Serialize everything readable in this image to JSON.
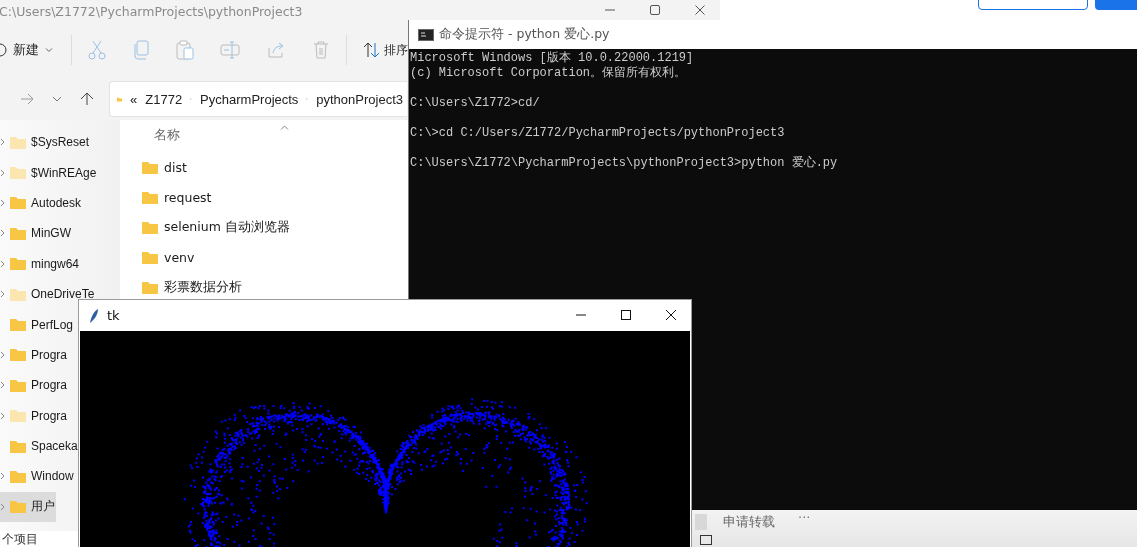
{
  "explorer": {
    "title": "C:\\Users\\Z1772\\PycharmProjects\\pythonProject3",
    "toolbar": {
      "new_label": "新建",
      "sort_label": "排序"
    },
    "address": {
      "prefix": "«",
      "segments": [
        "Z1772",
        "PycharmProjects",
        "pythonProject3"
      ]
    },
    "sidebar": {
      "items": [
        {
          "label": "$SysReset",
          "hidden": true,
          "expandable": true,
          "selected": false
        },
        {
          "label": "$WinREAge",
          "hidden": true,
          "expandable": true,
          "selected": false
        },
        {
          "label": "Autodesk",
          "hidden": false,
          "expandable": true,
          "selected": false
        },
        {
          "label": "MinGW",
          "hidden": false,
          "expandable": true,
          "selected": false
        },
        {
          "label": "mingw64",
          "hidden": false,
          "expandable": true,
          "selected": false
        },
        {
          "label": "OneDriveTe",
          "hidden": true,
          "expandable": true,
          "selected": false
        },
        {
          "label": "PerfLog",
          "hidden": false,
          "expandable": false,
          "selected": false
        },
        {
          "label": "Progra",
          "hidden": false,
          "expandable": true,
          "selected": false
        },
        {
          "label": "Progra",
          "hidden": false,
          "expandable": true,
          "selected": false
        },
        {
          "label": "Progra",
          "hidden": true,
          "expandable": true,
          "selected": false
        },
        {
          "label": "Spaceka",
          "hidden": false,
          "expandable": false,
          "selected": false
        },
        {
          "label": "Window",
          "hidden": false,
          "expandable": true,
          "selected": false
        },
        {
          "label": "用户",
          "hidden": false,
          "expandable": true,
          "selected": true
        }
      ]
    },
    "list": {
      "column": "名称",
      "items": [
        "dist",
        "request",
        "selenium 自动浏览器",
        "venv",
        "彩票数据分析"
      ]
    },
    "status_bar": "个项目"
  },
  "cmd": {
    "title": "命令提示符 - python  爱心.py",
    "lines": [
      {
        "text": "Microsoft Windows [版本 10.0.22000.1219]",
        "gap_before": false
      },
      {
        "text": "(c) Microsoft Corporation。保留所有权利。",
        "gap_before": false
      },
      {
        "text": "C:\\Users\\Z1772>cd/",
        "gap_before": true
      },
      {
        "text": "C:\\>cd C:/Users/Z1772/PycharmProjects/pythonProject3",
        "gap_before": true
      },
      {
        "text": "C:\\Users\\Z1772\\PycharmProjects\\pythonProject3>python 爱心.py",
        "gap_before": true
      }
    ]
  },
  "tk": {
    "title": "tk"
  },
  "background_page": {
    "items": [
      "申请转载",
      "···"
    ]
  }
}
